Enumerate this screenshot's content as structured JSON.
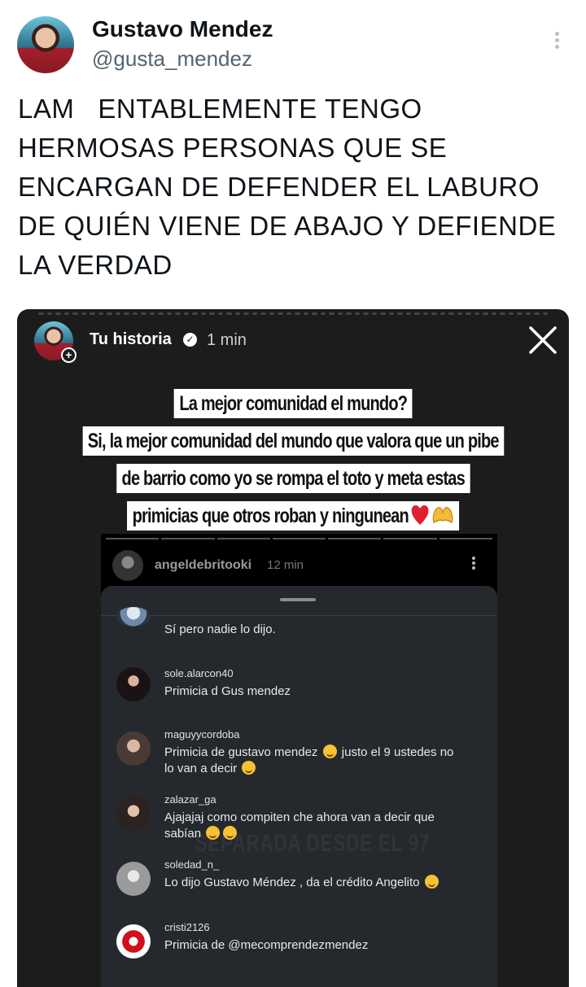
{
  "tweet": {
    "author_name": "Gustavo Mendez",
    "author_handle": "@gusta_mendez",
    "text": "LAM   ENTABLEMENTE TENGO\nHERMOSAS PERSONAS QUE SE\nENCARGAN DE DEFENDER EL LABURO\nDE QUIÉN VIENE DE ABAJO Y DEFIENDE\nLA VERDAD"
  },
  "story": {
    "title": "Tu historia",
    "time": "1 min",
    "caption_lines": [
      "La mejor comunidad el mundo?",
      "Si, la mejor comunidad del mundo que valora que un pibe",
      "de barrio como yo se rompa el toto y meta estas",
      "primicias que otros roban y ningunean"
    ],
    "inner": {
      "username": "angeldebritooki",
      "time": "12 min",
      "watermark": "SEPARADA DESDE EL 97",
      "comments": [
        {
          "user": "",
          "text": "Sí pero nadie lo dijo."
        },
        {
          "user": "sole.alarcon40",
          "text": "Primicia d Gus mendez"
        },
        {
          "user": "maguyycordoba",
          "text": "Primicia de gustavo mendez",
          "text2": "justo el 9 ustedes no",
          "text3": "lo van a decir"
        },
        {
          "user": "zalazar_ga",
          "text": "Ajajajaj como compiten che ahora van a decir que",
          "text2": "sabían"
        },
        {
          "user": "soledad_n_",
          "text": "Lo dijo Gustavo Méndez , da el crédito Angelito"
        },
        {
          "user": "cristi2126",
          "text": "Primicia de @mecomprendezmendez"
        }
      ]
    }
  },
  "colors": {
    "story_bg": "#1c1c1c",
    "sheet_bg": "#25292e",
    "handle_gray": "#536471"
  }
}
